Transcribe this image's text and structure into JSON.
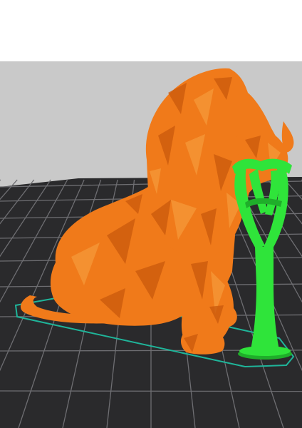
{
  "viewport": {
    "background_color": "#c9c9c9",
    "bed_color": "#2a2a2c",
    "bed_grid_color": "#6e6e72",
    "model_outline_color": "#1fb59a"
  },
  "model": {
    "name": "",
    "color": "#f07a1a",
    "shade_color": "#c95a0c",
    "highlight_color": "#f59a3a"
  },
  "support": {
    "color": "#2fe43a",
    "shade_color": "#1fae2a"
  }
}
